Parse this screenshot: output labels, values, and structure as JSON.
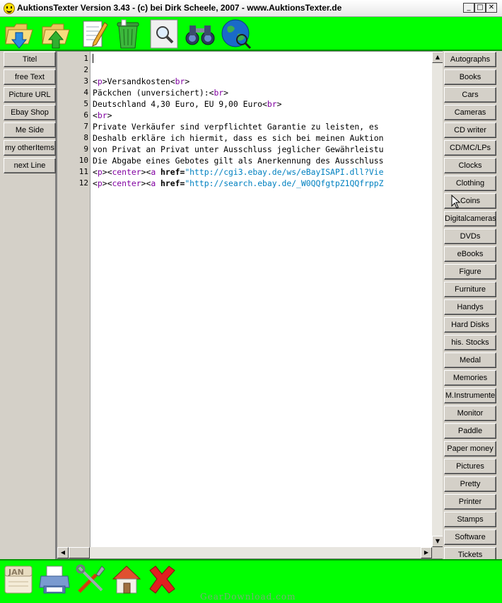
{
  "window": {
    "title": "AuktionsTexter Version 3.43 - (c) bei Dirk Scheele, 2007 - www.AuktionsTexter.de",
    "controls": {
      "minimize": "_",
      "maximize": "□",
      "close": "✕"
    }
  },
  "top_toolbar": {
    "icons": [
      "folder-open-icon",
      "folder-save-icon",
      "notepad-edit-icon",
      "recycle-bin-icon",
      "magnifier-icon",
      "binoculars-icon",
      "globe-search-icon"
    ]
  },
  "left_panel": {
    "buttons": [
      "Titel",
      "free Text",
      "Picture URL",
      "Ebay Shop",
      "Me Side",
      "my otherItems",
      "next Line"
    ]
  },
  "editor": {
    "line_numbers": [
      "1",
      "2",
      "3",
      "4",
      "5",
      "6",
      "7",
      "8",
      "9",
      "10",
      "11",
      "12"
    ],
    "lines": [
      [],
      [],
      [
        {
          "t": "<",
          "c": "tx"
        },
        {
          "t": "p",
          "c": "tg"
        },
        {
          "t": ">",
          "c": "tx"
        },
        {
          "t": "Versandkosten",
          "c": "tx"
        },
        {
          "t": "<",
          "c": "tx"
        },
        {
          "t": "br",
          "c": "tg"
        },
        {
          "t": ">",
          "c": "tx"
        }
      ],
      [
        {
          "t": "Päckchen (unversichert):",
          "c": "tx"
        },
        {
          "t": "<",
          "c": "tx"
        },
        {
          "t": "br",
          "c": "tg"
        },
        {
          "t": ">",
          "c": "tx"
        }
      ],
      [
        {
          "t": "Deutschland 4,30 Euro, EU 9,00 Euro",
          "c": "tx"
        },
        {
          "t": "<",
          "c": "tx"
        },
        {
          "t": "br",
          "c": "tg"
        },
        {
          "t": ">",
          "c": "tx"
        }
      ],
      [
        {
          "t": "<",
          "c": "tx"
        },
        {
          "t": "br",
          "c": "tg"
        },
        {
          "t": ">",
          "c": "tx"
        }
      ],
      [
        {
          "t": "Private Verkäufer sind verpflichtet Garantie zu leisten, es",
          "c": "tx"
        }
      ],
      [
        {
          "t": "Deshalb erkläre ich hiermit, dass es sich bei meinen Auktion",
          "c": "tx"
        }
      ],
      [
        {
          "t": "von Privat an Privat unter Ausschluss jeglicher Gewährleistu",
          "c": "tx"
        }
      ],
      [
        {
          "t": "Die Abgabe eines Gebotes gilt als Anerkennung des Ausschluss",
          "c": "tx"
        }
      ],
      [
        {
          "t": "<",
          "c": "tx"
        },
        {
          "t": "p",
          "c": "tg"
        },
        {
          "t": "><",
          "c": "tx"
        },
        {
          "t": "center",
          "c": "tg"
        },
        {
          "t": "><",
          "c": "tx"
        },
        {
          "t": "a",
          "c": "tg"
        },
        {
          "t": " ",
          "c": "tx"
        },
        {
          "t": "href=",
          "c": "kw"
        },
        {
          "t": "\"http://cgi3.ebay.de/ws/eBayISAPI.dll?Vie",
          "c": "st"
        }
      ],
      [
        {
          "t": "<",
          "c": "tx"
        },
        {
          "t": "p",
          "c": "tg"
        },
        {
          "t": "><",
          "c": "tx"
        },
        {
          "t": "center",
          "c": "tg"
        },
        {
          "t": "><",
          "c": "tx"
        },
        {
          "t": "a",
          "c": "tg"
        },
        {
          "t": " ",
          "c": "tx"
        },
        {
          "t": "href=",
          "c": "kw"
        },
        {
          "t": "\"http://search.ebay.de/_W0QQfgtpZ1QQfrppZ",
          "c": "st"
        }
      ]
    ],
    "scroll": {
      "up": "▲",
      "down": "▼",
      "left": "◀",
      "right": "▶"
    }
  },
  "right_panel": {
    "buttons": [
      "Autographs",
      "Books",
      "Cars",
      "Cameras",
      "CD writer",
      "CD/MC/LPs",
      "Clocks",
      "Clothing",
      "Coins",
      "Digitalcameras",
      "DVDs",
      "eBooks",
      "Figure",
      "Furniture",
      "Handys",
      "Hard Disks",
      "his. Stocks",
      "Medal",
      "Memories",
      "M.Instrumente",
      "Monitor",
      "Paddle",
      "Paper money",
      "Pictures",
      "Pretty",
      "Printer",
      "Stamps",
      "Software",
      "Tickets"
    ]
  },
  "bottom_toolbar": {
    "icons": [
      "calendar-icon",
      "printer-icon",
      "tools-icon",
      "home-icon",
      "close-x-icon"
    ],
    "calendar_label": "JAN"
  },
  "watermark": "GearDownload.com",
  "colors": {
    "toolbar_green": "#00ff00",
    "tag_purple": "#8000a0",
    "string_blue": "#0080c0",
    "panel_gray": "#d4d0c8"
  }
}
